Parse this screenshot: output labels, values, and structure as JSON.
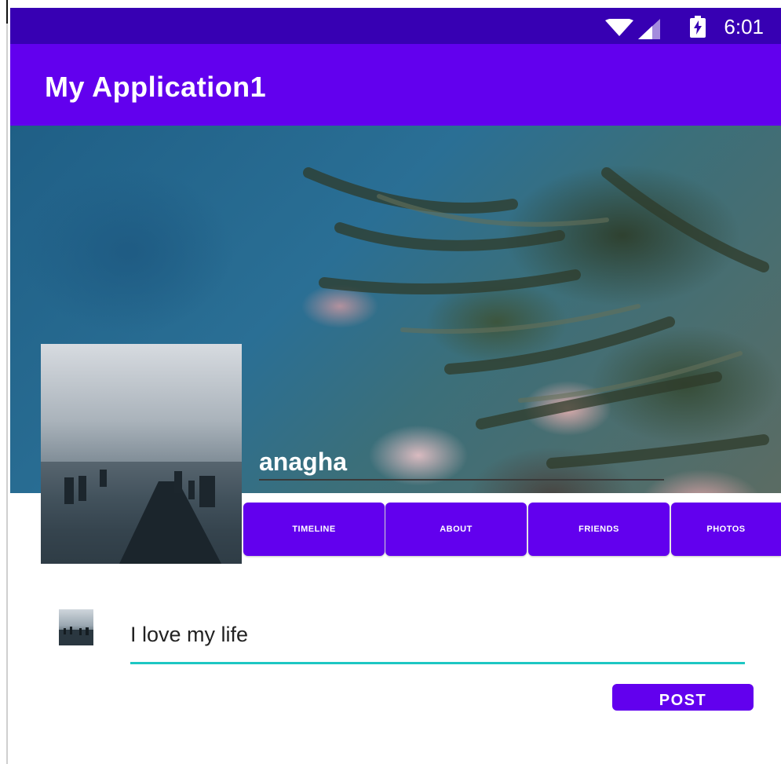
{
  "status_bar": {
    "time": "6:01",
    "icons": [
      "wifi-icon",
      "signal-icon",
      "battery-charging-icon"
    ],
    "color": "#3700b3"
  },
  "app_bar": {
    "title": "My Application1",
    "color": "#6200ee"
  },
  "profile": {
    "name": "anagha"
  },
  "tabs": [
    {
      "label": "TIMELINE"
    },
    {
      "label": "ABOUT"
    },
    {
      "label": "FRIENDS"
    },
    {
      "label": "PHOTOS"
    }
  ],
  "post": {
    "input_value": "I love my life",
    "button_label": "POST",
    "accent_color": "#1ec7c3"
  }
}
